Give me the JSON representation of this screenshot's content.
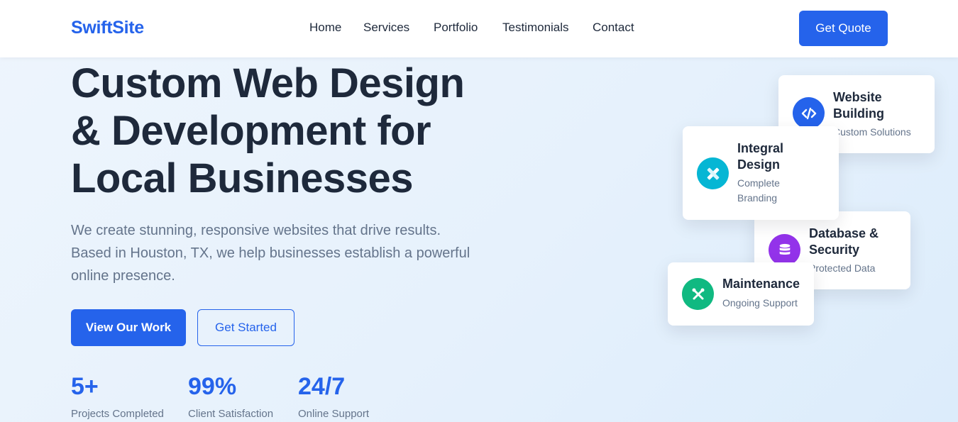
{
  "header": {
    "logo": "SwiftSite",
    "nav": [
      "Home",
      "Services",
      "Portfolio",
      "Testimonials",
      "Contact"
    ],
    "cta_label": "Get Quote"
  },
  "hero": {
    "title_lines": [
      "Custom Web Design",
      "& Development for",
      "Local Businesses"
    ],
    "description_lines": [
      "We create stunning, responsive websites that drive results.",
      "Based in Houston, TX, we help businesses establish a powerful",
      "online presence."
    ],
    "primary_button": "View Our Work",
    "secondary_button": "Get Started"
  },
  "stats": [
    {
      "value": "5+",
      "label": "Projects Completed"
    },
    {
      "value": "99%",
      "label": "Client Satisfaction"
    },
    {
      "value": "24/7",
      "label": "Online Support"
    }
  ],
  "cards": [
    {
      "title_lines": [
        "Website",
        "Building"
      ],
      "subtitle_lines": [
        "Custom Solutions"
      ],
      "icon": "code-icon",
      "color": "#2563eb"
    },
    {
      "title_lines": [
        "Integral",
        "Design"
      ],
      "subtitle_lines": [
        "Complete",
        "Branding"
      ],
      "icon": "design-tools-icon",
      "color": "#06b6d4"
    },
    {
      "title_lines": [
        "Database &",
        "Security"
      ],
      "subtitle_lines": [
        "Protected Data"
      ],
      "icon": "database-icon",
      "color": "#9333ea"
    },
    {
      "title_lines": [
        "Maintenance"
      ],
      "subtitle_lines": [
        "Ongoing Support"
      ],
      "icon": "tools-icon",
      "color": "#10b981"
    }
  ],
  "colors": {
    "accent": "#2563eb",
    "heading": "#1e293b",
    "muted": "#64748b"
  }
}
